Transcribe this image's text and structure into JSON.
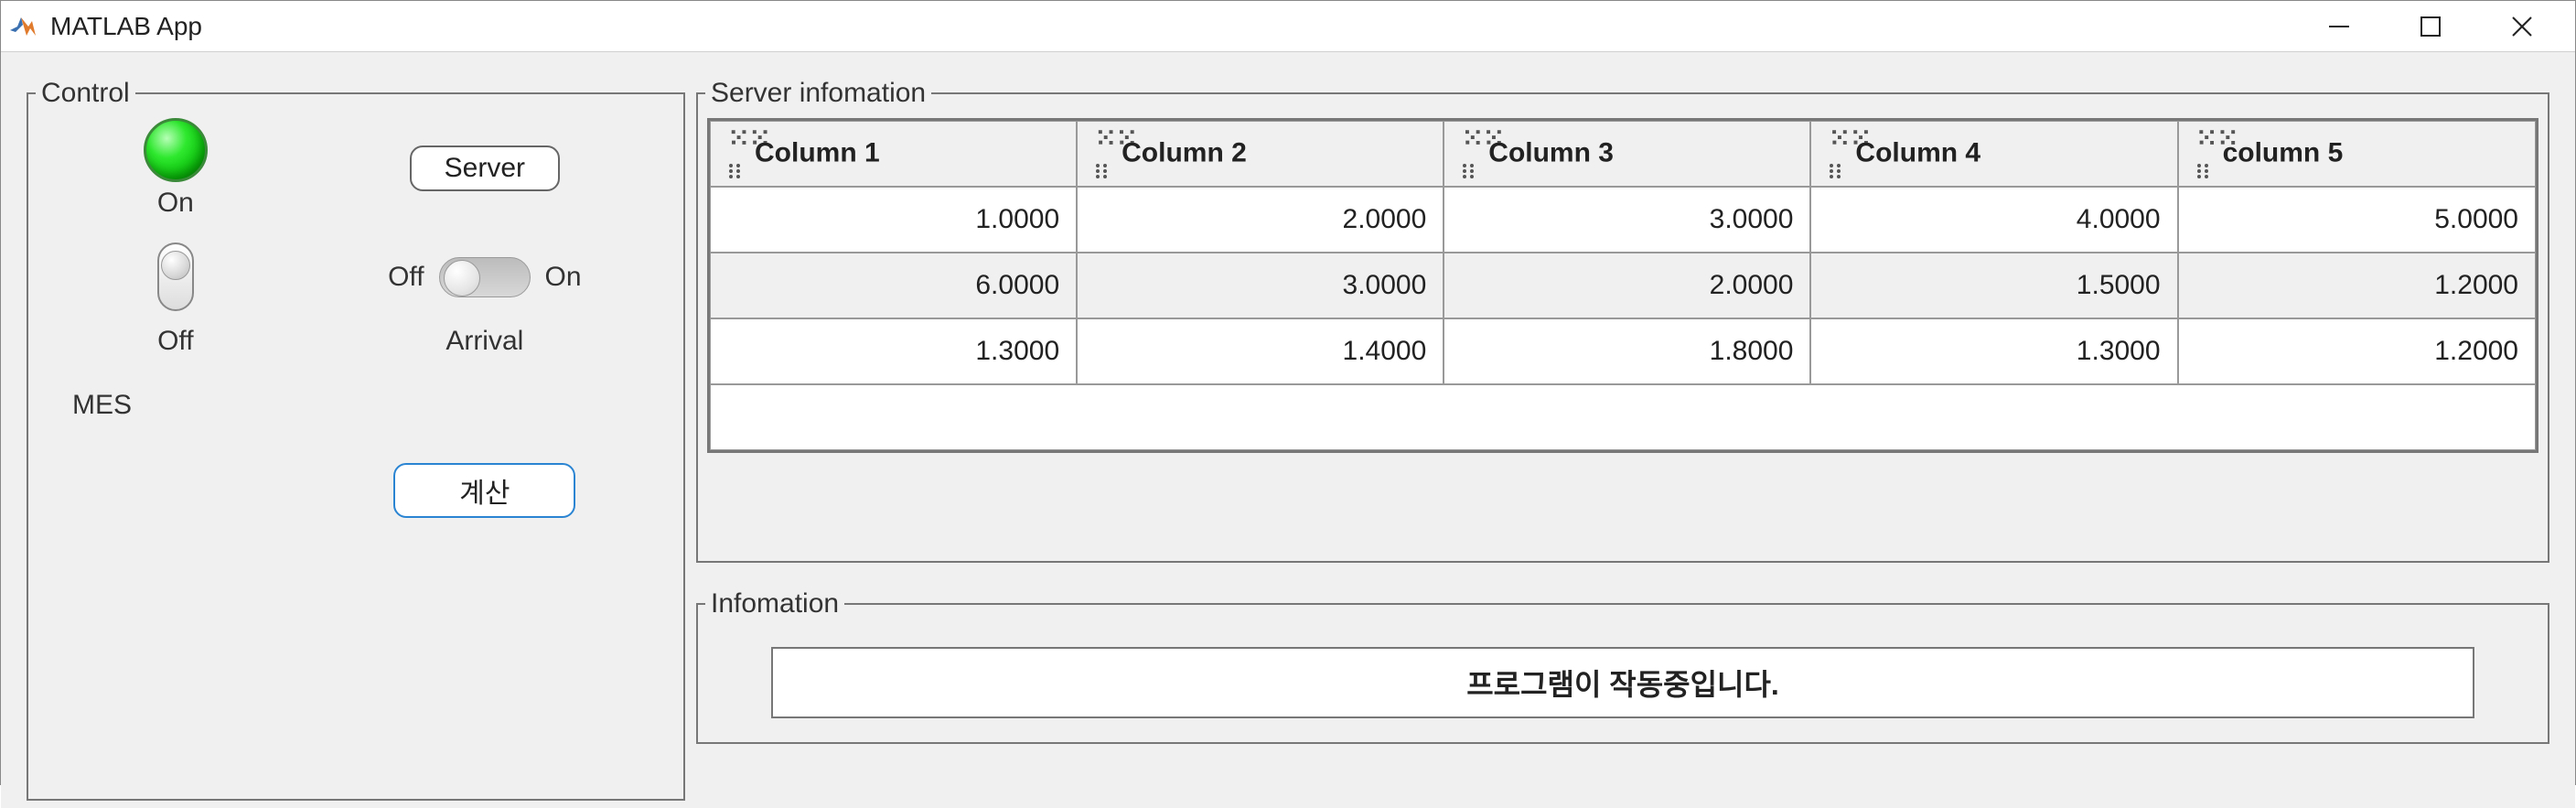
{
  "window": {
    "title": "MATLAB App"
  },
  "control": {
    "legend": "Control",
    "lamp_label": "On",
    "server_button": "Server",
    "rocker_bottom_label": "Off",
    "toggle_left": "Off",
    "toggle_right": "On",
    "arrival_label": "Arrival",
    "mes_label": "MES",
    "calc_button": "계산"
  },
  "server_info": {
    "legend": "Server infomation",
    "columns": [
      "Column 1",
      "Column 2",
      "Column 3",
      "Column 4",
      "column 5"
    ],
    "rows": [
      [
        "1.0000",
        "2.0000",
        "3.0000",
        "4.0000",
        "5.0000"
      ],
      [
        "6.0000",
        "3.0000",
        "2.0000",
        "1.5000",
        "1.2000"
      ],
      [
        "1.3000",
        "1.4000",
        "1.8000",
        "1.3000",
        "1.2000"
      ]
    ]
  },
  "info": {
    "legend": "Infomation",
    "message": "프로그램이 작동중입니다."
  }
}
